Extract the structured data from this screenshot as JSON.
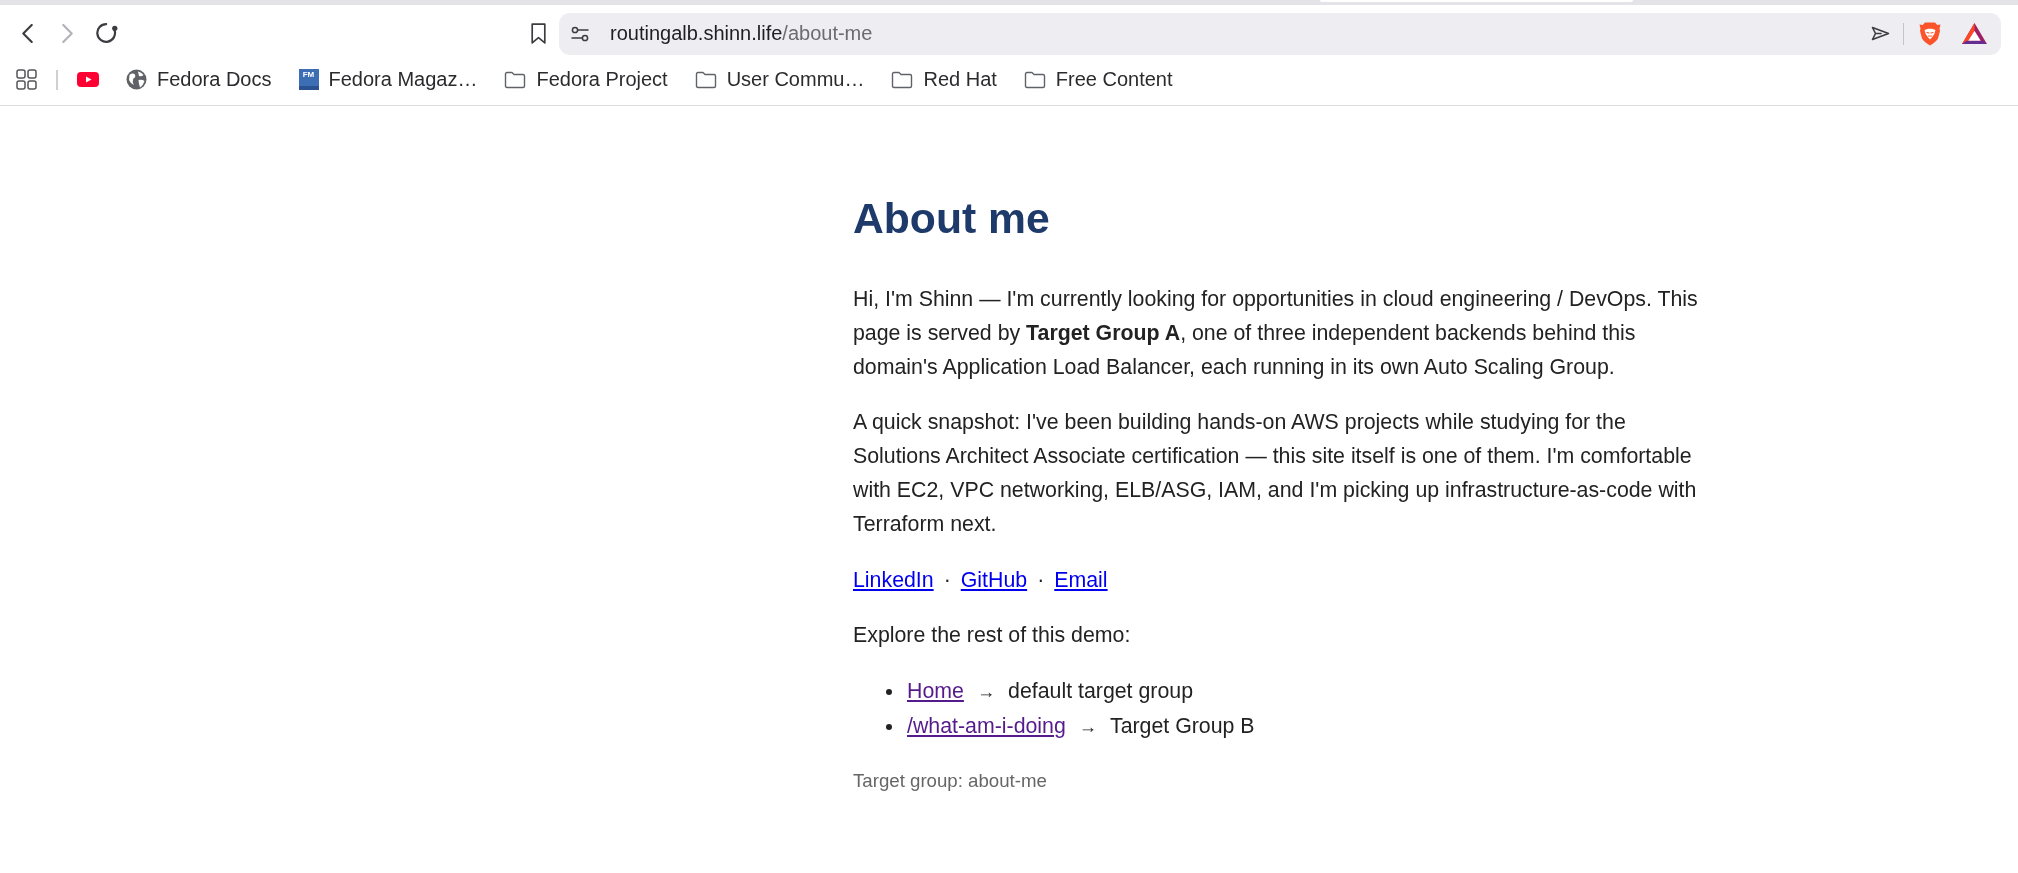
{
  "browser": {
    "nav_buttons": [
      {
        "kind": "back",
        "disabled": false
      },
      {
        "kind": "forward",
        "disabled": true
      },
      {
        "kind": "reload",
        "disabled": false
      }
    ],
    "address_bar": {
      "host": "routingalb.shinn.life",
      "path": "/about-me"
    },
    "bookmarks": [
      {
        "kind": "video"
      },
      {
        "kind": "globe",
        "label": "Fedora Docs"
      },
      {
        "kind": "magazine",
        "badge": "FM",
        "label": "Fedora Magaz…"
      },
      {
        "kind": "folder",
        "label": "Fedora Project"
      },
      {
        "kind": "folder",
        "label": "User Commu…"
      },
      {
        "kind": "folder",
        "label": "Red Hat"
      },
      {
        "kind": "folder",
        "label": "Free Content"
      }
    ]
  },
  "page": {
    "heading": "About me",
    "paragraphs": [
      "Hi, I'm Shinn — I'm currently looking for opportunities in cloud engineering / DevOps. This page is served by **Target Group A**, one of three independent backends behind this domain's Application Load Balancer, each running in its own Auto Scaling Group.",
      "A quick snapshot: I've been building hands-on AWS projects while studying for the Solutions Architect Associate certification — this site itself is one of them. I'm comfortable with EC2, VPC networking, ELB/ASG, IAM, and I'm picking up infrastructure-as-code with Terraform next."
    ],
    "contact_links": [
      {
        "label": "LinkedIn",
        "visited": false
      },
      {
        "label": "GitHub",
        "visited": false
      },
      {
        "label": "Email",
        "visited": false
      }
    ],
    "link_separators": [
      "·",
      "·"
    ],
    "explore_text": "Explore the rest of this demo:",
    "routes": [
      {
        "link": "Home",
        "visited": true,
        "arrow": "→",
        "target": "default target group"
      },
      {
        "link": "/what-am-i-doing",
        "visited": true,
        "arrow": "→",
        "target": "Target Group B"
      }
    ],
    "footer": "Target group: about-me"
  }
}
